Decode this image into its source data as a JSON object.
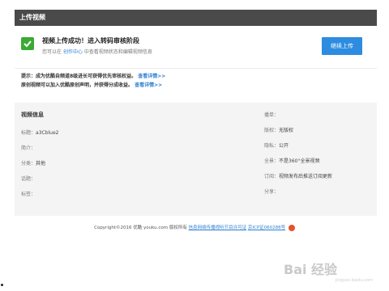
{
  "header": {
    "title": "上传视频"
  },
  "success": {
    "title": "视频上传成功！进入转码审核阶段",
    "sub_prefix": "您可以在",
    "sub_link": "创作中心",
    "sub_suffix": "中查看视频状态和编辑视频信息",
    "continue_label": "继续上传",
    "accent": "#3aaa35"
  },
  "tips": [
    {
      "text": "提示：成为优酷自频道8级进长可获得优先审核权益。",
      "more": "查看详情>>"
    },
    {
      "text": "原创视频可以加入优酷原创声明，并获得分成收益。",
      "more": "查看详情>>"
    }
  ],
  "info": {
    "heading": "视频信息",
    "left_rows": [
      {
        "label": "标题：",
        "value": "a3Cblue2"
      },
      {
        "label": "简介：",
        "value": ""
      },
      {
        "label": "分类：",
        "value": "其他"
      },
      {
        "label": "话题：",
        "value": ""
      },
      {
        "label": "标签：",
        "value": ""
      }
    ],
    "right_rows": [
      {
        "label": "播单：",
        "value": ""
      },
      {
        "label": "版权：",
        "value": "无版权"
      },
      {
        "label": "隐私：",
        "value": "公开"
      },
      {
        "label": "全景：",
        "value": "不是360°全景视频"
      },
      {
        "label": "订阅：",
        "value": "视频发布后推送订阅更新"
      },
      {
        "label": "分享：",
        "value": ""
      }
    ]
  },
  "footer": {
    "copyright": "Copyright©2016 优酷 youku.com 版权所有",
    "link1": "信息网络传播视听节目许可证",
    "link2": "京ICP证060288号"
  },
  "watermark": {
    "brand": "Bai 经验",
    "sub": "jingyan.baidu.com"
  }
}
